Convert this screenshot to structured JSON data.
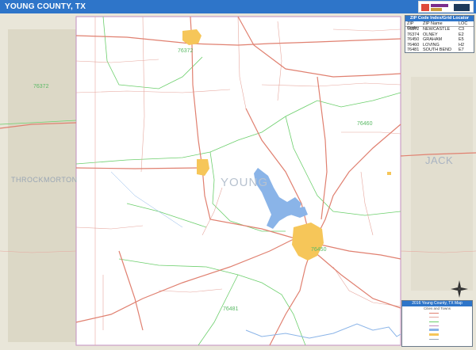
{
  "header": {
    "title": "YOUNG COUNTY, TX",
    "brand_color": "#2e75c9"
  },
  "map": {
    "county_name": "YOUNG",
    "neighbor_counties": [
      "THROCKMORTON",
      "JACK"
    ],
    "zip_labels": [
      "76372",
      "76372",
      "76460",
      "76450",
      "76481"
    ],
    "colors": {
      "highway": "#e08070",
      "road": "#e6a79e",
      "zip_boundary": "#6ccf6c",
      "county_border": "#c28fc0",
      "neighbor_fill": "#e9e6d9",
      "water": "#8ab4e8",
      "city": "#f6c659"
    }
  },
  "zip_index": {
    "title": "ZIP Code Index/Grid Locator",
    "headers": [
      "ZIP Code",
      "ZIP Name",
      "LOC"
    ],
    "rows": [
      [
        "76372",
        "NEWCASTLE",
        "C3"
      ],
      [
        "76374",
        "OLNEY",
        "E2"
      ],
      [
        "76450",
        "GRAHAM",
        "E5"
      ],
      [
        "76460",
        "LOVING",
        "H2"
      ],
      [
        "76481",
        "SOUTH BEND",
        "E7"
      ]
    ]
  },
  "legend": {
    "title": "2016 Young County, TX Map",
    "subtitle": "Cities and Towns"
  },
  "compass": {
    "icon": "compass-rose-icon"
  }
}
